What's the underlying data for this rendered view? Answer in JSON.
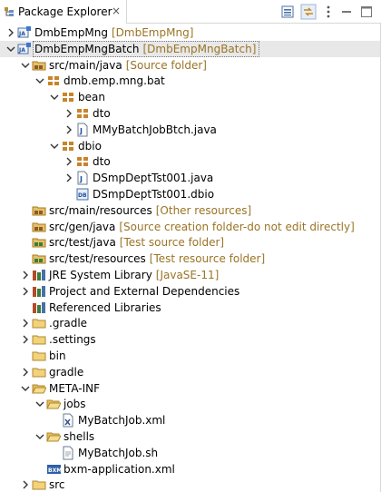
{
  "view": {
    "title": "Package Explorer",
    "close_glyph": "×",
    "toolbar": [
      {
        "name": "collapse-all-icon"
      },
      {
        "name": "link-with-editor-icon"
      },
      {
        "name": "view-menu-icon"
      },
      {
        "name": "minimize-icon"
      },
      {
        "name": "maximize-icon"
      }
    ]
  },
  "tree": {
    "selected_index": 1,
    "rows": [
      {
        "depth": 0,
        "twisty": "collapsed",
        "icon": "java-project-icon",
        "label": "DmbEmpMng",
        "decoration": "[DmbEmpMng]"
      },
      {
        "depth": 0,
        "twisty": "expanded",
        "icon": "java-project-icon",
        "label": "DmbEmpMngBatch",
        "decoration": "[DmbEmpMngBatch]"
      },
      {
        "depth": 1,
        "twisty": "expanded",
        "icon": "source-folder-icon",
        "label": "src/main/java",
        "decoration": "[Source folder]"
      },
      {
        "depth": 2,
        "twisty": "expanded",
        "icon": "package-icon",
        "label": "dmb.emp.mng.bat",
        "decoration": ""
      },
      {
        "depth": 3,
        "twisty": "expanded",
        "icon": "package-icon",
        "label": "bean",
        "decoration": ""
      },
      {
        "depth": 4,
        "twisty": "collapsed",
        "icon": "package-icon",
        "label": "dto",
        "decoration": ""
      },
      {
        "depth": 4,
        "twisty": "collapsed",
        "icon": "java-file-icon",
        "label": "MMyBatchJobBtch.java",
        "decoration": ""
      },
      {
        "depth": 3,
        "twisty": "expanded",
        "icon": "package-icon",
        "label": "dbio",
        "decoration": ""
      },
      {
        "depth": 4,
        "twisty": "collapsed",
        "icon": "package-icon",
        "label": "dto",
        "decoration": ""
      },
      {
        "depth": 4,
        "twisty": "collapsed",
        "icon": "java-file-icon",
        "label": "DSmpDeptTst001.java",
        "decoration": ""
      },
      {
        "depth": 4,
        "twisty": "none",
        "icon": "dbio-file-icon",
        "label": "DSmpDeptTst001.dbio",
        "decoration": ""
      },
      {
        "depth": 1,
        "twisty": "none",
        "icon": "source-folder-icon",
        "label": "src/main/resources",
        "decoration": "[Other resources]"
      },
      {
        "depth": 1,
        "twisty": "none",
        "icon": "source-folder-icon",
        "label": "src/gen/java",
        "decoration": "[Source creation folder-do not edit directly]"
      },
      {
        "depth": 1,
        "twisty": "none",
        "icon": "test-source-folder-icon",
        "label": "src/test/java",
        "decoration": "[Test source folder]"
      },
      {
        "depth": 1,
        "twisty": "none",
        "icon": "test-source-folder-icon",
        "label": "src/test/resources",
        "decoration": "[Test resource folder]"
      },
      {
        "depth": 1,
        "twisty": "collapsed",
        "icon": "library-icon",
        "label": "JRE System Library",
        "decoration": "[JavaSE-11]"
      },
      {
        "depth": 1,
        "twisty": "collapsed",
        "icon": "library-icon",
        "label": "Project and External Dependencies",
        "decoration": ""
      },
      {
        "depth": 1,
        "twisty": "none",
        "icon": "library-icon",
        "label": "Referenced Libraries",
        "decoration": ""
      },
      {
        "depth": 1,
        "twisty": "collapsed",
        "icon": "folder-icon",
        "label": ".gradle",
        "decoration": ""
      },
      {
        "depth": 1,
        "twisty": "collapsed",
        "icon": "folder-icon",
        "label": ".settings",
        "decoration": ""
      },
      {
        "depth": 1,
        "twisty": "none",
        "icon": "folder-icon",
        "label": "bin",
        "decoration": ""
      },
      {
        "depth": 1,
        "twisty": "collapsed",
        "icon": "folder-icon",
        "label": "gradle",
        "decoration": ""
      },
      {
        "depth": 1,
        "twisty": "expanded",
        "icon": "open-folder-icon",
        "label": "META-INF",
        "decoration": ""
      },
      {
        "depth": 2,
        "twisty": "expanded",
        "icon": "open-folder-icon",
        "label": "jobs",
        "decoration": ""
      },
      {
        "depth": 3,
        "twisty": "none",
        "icon": "xml-file-icon",
        "label": "MyBatchJob.xml",
        "decoration": ""
      },
      {
        "depth": 2,
        "twisty": "expanded",
        "icon": "open-folder-icon",
        "label": "shells",
        "decoration": ""
      },
      {
        "depth": 3,
        "twisty": "none",
        "icon": "file-icon",
        "label": "MyBatchJob.sh",
        "decoration": ""
      },
      {
        "depth": 2,
        "twisty": "none",
        "icon": "bxm-file-icon",
        "label": "bxm-application.xml",
        "decoration": ""
      },
      {
        "depth": 1,
        "twisty": "collapsed",
        "icon": "folder-icon",
        "label": "src",
        "decoration": ""
      }
    ]
  }
}
